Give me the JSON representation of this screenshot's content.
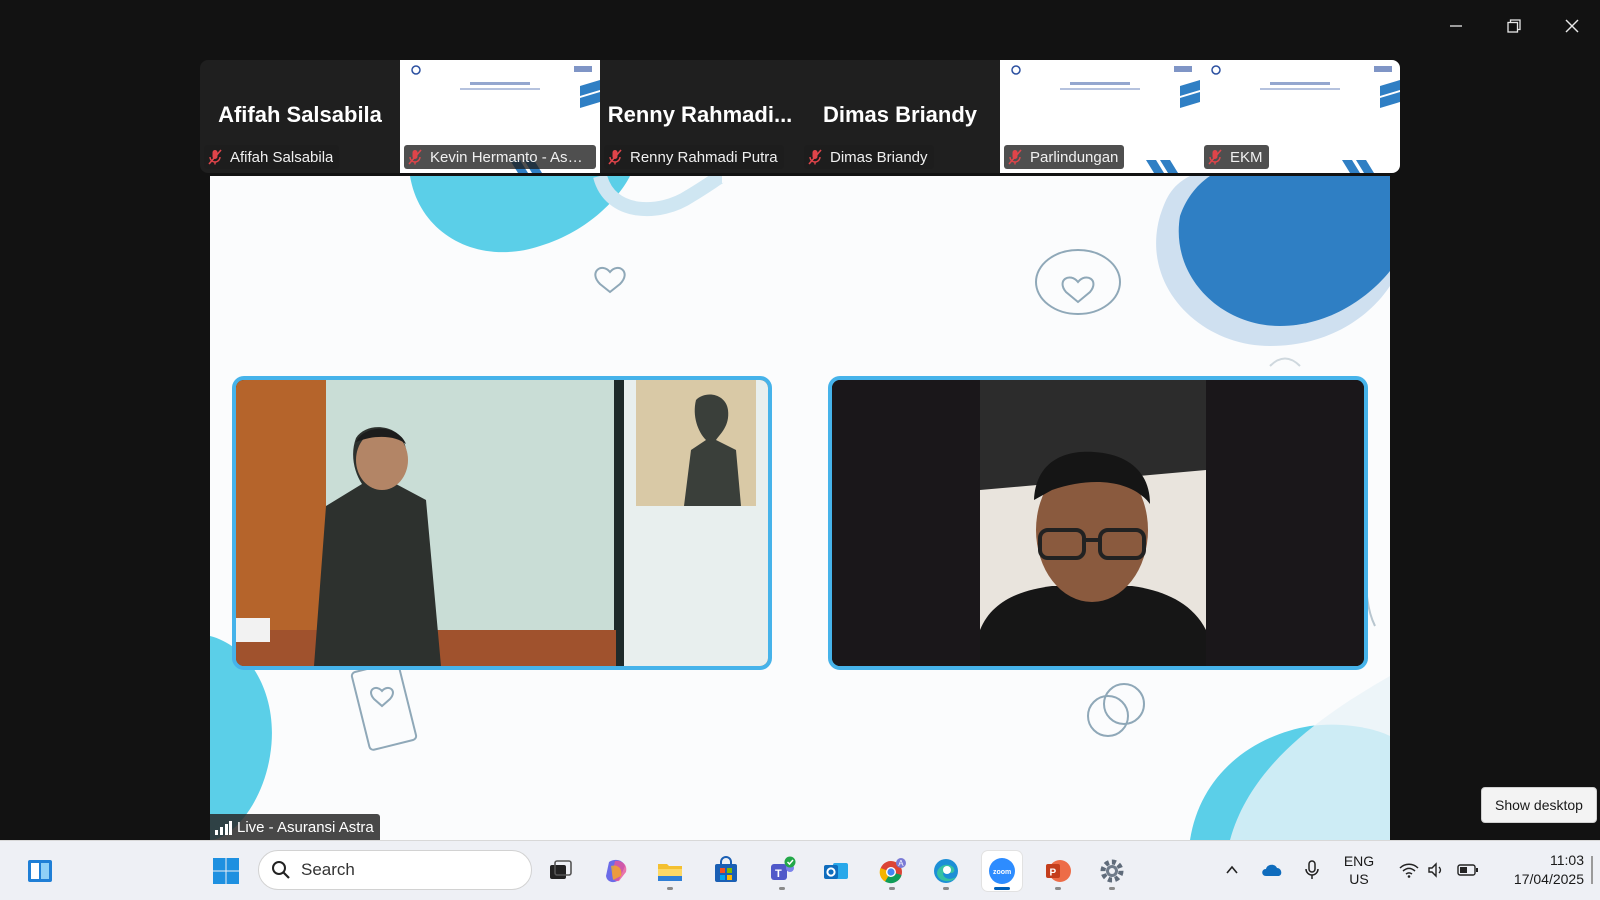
{
  "window_controls": {
    "minimize": "minimize-icon",
    "restore": "restore-icon",
    "close": "close-icon"
  },
  "participants": [
    {
      "display": "name",
      "big_name": "Afifah Salsabila",
      "label": "Afifah Salsabila",
      "muted": true
    },
    {
      "display": "slide",
      "big_name": "",
      "label": "Kevin Hermanto - Asur...",
      "muted": true
    },
    {
      "display": "name",
      "big_name": "Renny  Rahmadi...",
      "label": "Renny Rahmadi Putra",
      "muted": true
    },
    {
      "display": "name",
      "big_name": "Dimas Briandy",
      "label": "Dimas Briandy",
      "muted": true
    },
    {
      "display": "slide",
      "big_name": "",
      "label": "Parlindungan",
      "muted": true
    },
    {
      "display": "slide",
      "big_name": "",
      "label": "EKM",
      "muted": true
    }
  ],
  "share": {
    "live_label": "Live - Asuransi Astra",
    "accent": "#46b3ea",
    "blob_light": "#5bcfe8",
    "blob_dark": "#2f7fc4"
  },
  "show_desktop_tooltip": "Show desktop",
  "taskbar": {
    "search_placeholder": "Search",
    "icons": [
      "widgets-icon",
      "start-icon",
      "task-view-icon",
      "copilot-icon",
      "file-explorer-icon",
      "microsoft-store-icon",
      "teams-icon",
      "outlook-icon",
      "chrome-icon",
      "edge-icon",
      "zoom-icon",
      "powerpoint-icon",
      "settings-icon"
    ],
    "active_app": "zoom-icon",
    "tray": {
      "lang_line1": "ENG",
      "lang_line2": "US",
      "time": "11:03",
      "date": "17/04/2025"
    }
  }
}
